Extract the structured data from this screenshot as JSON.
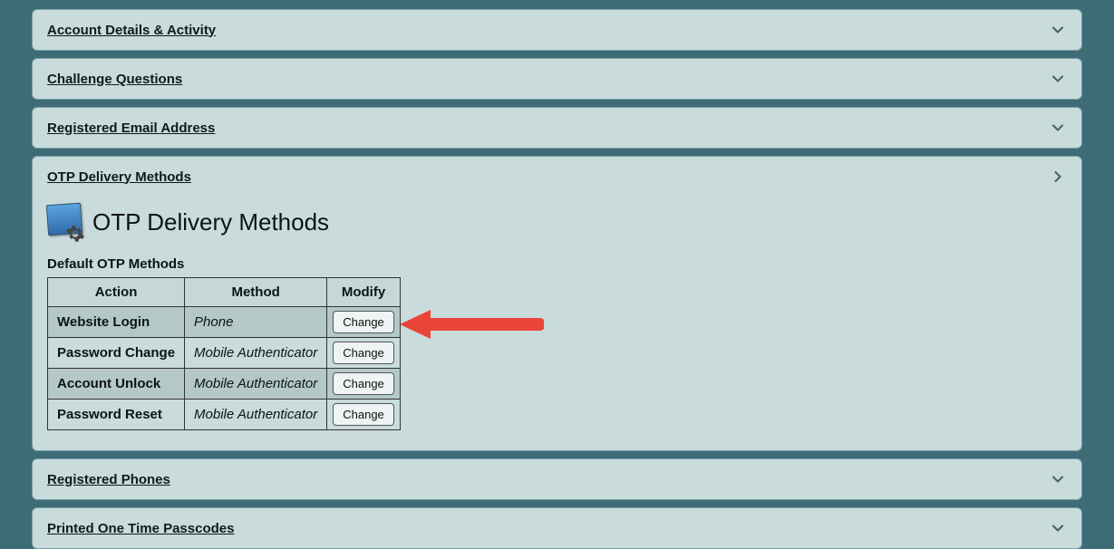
{
  "panels": {
    "account": "Account Details & Activity",
    "challenge": "Challenge Questions",
    "email": "Registered Email Address",
    "otp": "OTP Delivery Methods",
    "phones": "Registered Phones",
    "printed": "Printed One Time Passcodes"
  },
  "otp": {
    "sectionTitle": "OTP Delivery Methods",
    "subtitle": "Default OTP Methods",
    "headers": {
      "action": "Action",
      "method": "Method",
      "modify": "Modify"
    },
    "rows": [
      {
        "action": "Website Login",
        "method": "Phone",
        "button": "Change",
        "highlight": true
      },
      {
        "action": "Password Change",
        "method": "Mobile Authenticator",
        "button": "Change",
        "highlight": false
      },
      {
        "action": "Account Unlock",
        "method": "Mobile Authenticator",
        "button": "Change",
        "highlight": true
      },
      {
        "action": "Password Reset",
        "method": "Mobile Authenticator",
        "button": "Change",
        "highlight": false
      }
    ]
  }
}
